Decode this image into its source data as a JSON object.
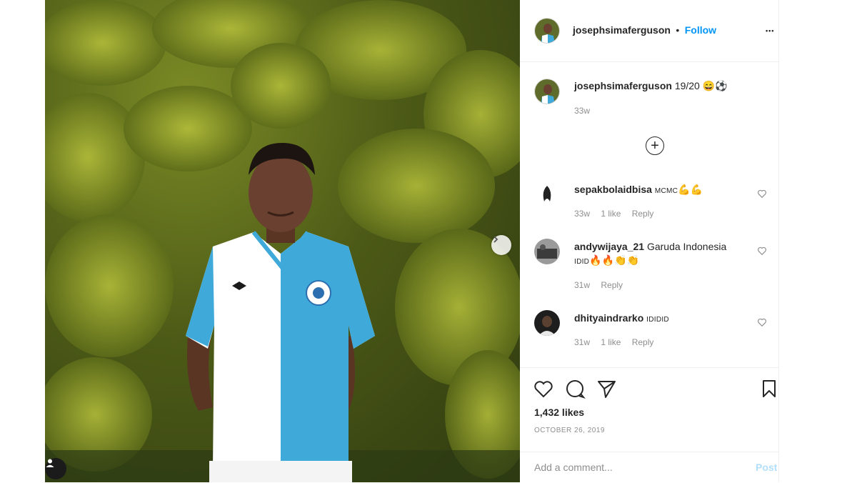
{
  "post": {
    "username": "josephsimaferguson",
    "follow_label": "Follow",
    "separator": "•",
    "more_label": "•••",
    "caption_text": "19/20 😄⚽",
    "caption_time": "33w",
    "load_more_label": "+"
  },
  "comments": [
    {
      "username": "sepakbolaidbisa",
      "text": "MCMC",
      "emoji": "💪💪",
      "time": "33w",
      "likes": "1 like",
      "reply": "Reply"
    },
    {
      "username": "andywijaya_21",
      "text": "Garuda Indonesia",
      "text2": "IDID",
      "emoji": "🔥🔥👏👏",
      "time": "31w",
      "likes": "",
      "reply": "Reply"
    },
    {
      "username": "dhityaindrarko",
      "text": "IDIDID",
      "emoji": "",
      "time": "31w",
      "likes": "1 like",
      "reply": "Reply"
    }
  ],
  "actions": {
    "likes": "1,432 likes",
    "date": "OCTOBER 26, 2019"
  },
  "add_comment": {
    "placeholder": "Add a comment...",
    "post_label": "Post"
  },
  "colors": {
    "accent": "#0095f6",
    "post_disabled": "#b2dffc",
    "jersey_blue": "#3fa9d9"
  },
  "icons": [
    "chevron-right-icon",
    "user-tag-icon",
    "more-options-icon",
    "add-circle-icon",
    "heart-icon",
    "comment-icon",
    "share-icon",
    "bookmark-icon"
  ]
}
